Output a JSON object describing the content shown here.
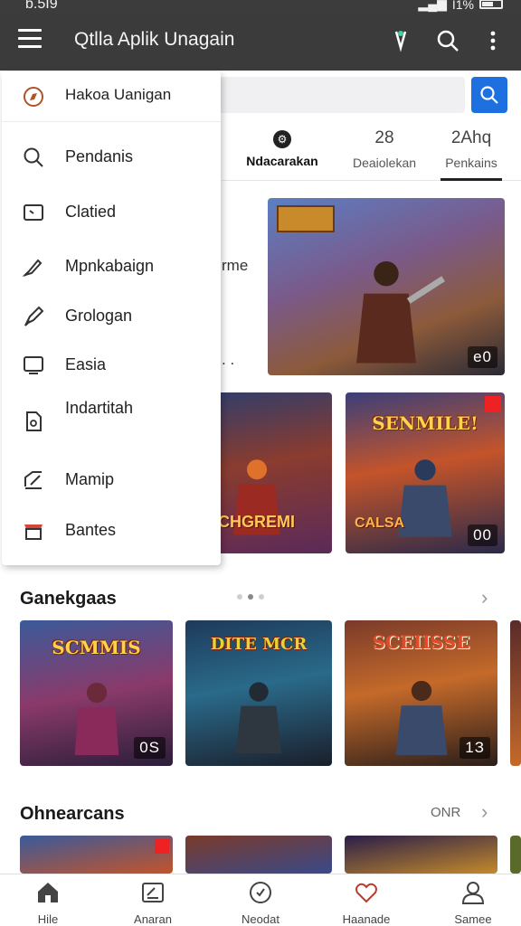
{
  "status_bar": {
    "time": "b.5I9",
    "battery": "I1%"
  },
  "app_bar": {
    "title": "Qtlla Aplik Unagain"
  },
  "search": {
    "placeholder": ""
  },
  "tabs": [
    {
      "top": "",
      "label": "Ndacarakan"
    },
    {
      "top": "28",
      "label": "Deaiolekan"
    },
    {
      "top": "2Ahq",
      "label": "Penkains"
    }
  ],
  "peek": {
    "word": "rme",
    "dots": ". ."
  },
  "cards_top": [
    {
      "count": "e0"
    },
    {
      "banner": "",
      "sub": "CHGREMI",
      "count": ""
    },
    {
      "banner": "SENMILE!",
      "sub": "CALSA",
      "count": "00"
    }
  ],
  "section1": {
    "title": "Ganekgaas"
  },
  "section1_cards": [
    {
      "banner": "SCMMIS",
      "count": "0S"
    },
    {
      "banner": "DITE MCR",
      "count": ""
    },
    {
      "banner": "SCEIISSE",
      "count": "1З"
    }
  ],
  "section2": {
    "title": "Ohnearcans",
    "more": "ONR"
  },
  "drawer": {
    "header": "Hakoa Uanigan",
    "items": [
      {
        "label": "Pendanis",
        "icon": "search-icon"
      },
      {
        "label": "Clatied",
        "icon": "tag-icon"
      },
      {
        "label": "Mpnkabaign",
        "icon": "brush-icon"
      },
      {
        "label": "Grologan",
        "icon": "pen-icon"
      },
      {
        "label": "Easia",
        "icon": "monitor-icon"
      },
      {
        "label": "Indartitah",
        "icon": "file-icon"
      },
      {
        "label": "Mamip",
        "icon": "edit-icon"
      },
      {
        "label": "Bantes",
        "icon": "shop-icon"
      }
    ]
  },
  "bottom_nav": [
    {
      "label": "Hile",
      "icon": "home-icon"
    },
    {
      "label": "Anaran",
      "icon": "note-icon"
    },
    {
      "label": "Neodat",
      "icon": "timer-icon"
    },
    {
      "label": "Haanade",
      "icon": "heart-icon"
    },
    {
      "label": "Samee",
      "icon": "profile-icon"
    }
  ],
  "colors": {
    "appbar": "#3b3b3b",
    "accent": "#1e6fe0"
  }
}
